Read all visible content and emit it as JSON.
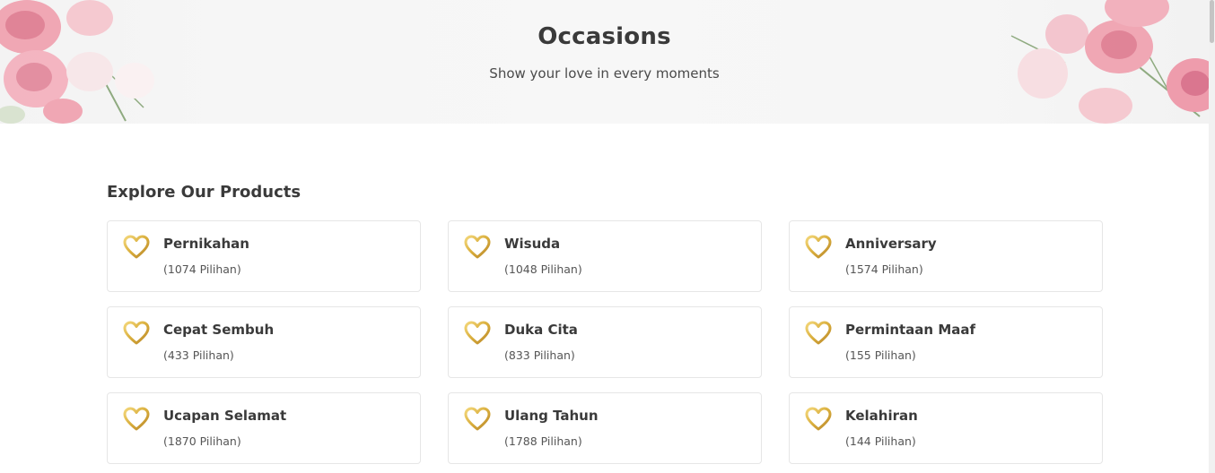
{
  "hero": {
    "title": "Occasions",
    "subtitle": "Show your love in every moments"
  },
  "section": {
    "title": "Explore Our Products"
  },
  "categories": [
    {
      "name": "Pernikahan",
      "count": "(1074 Pilihan)"
    },
    {
      "name": "Wisuda",
      "count": "(1048 Pilihan)"
    },
    {
      "name": "Anniversary",
      "count": "(1574 Pilihan)"
    },
    {
      "name": "Cepat Sembuh",
      "count": "(433 Pilihan)"
    },
    {
      "name": "Duka Cita",
      "count": "(833 Pilihan)"
    },
    {
      "name": "Permintaan Maaf",
      "count": "(155 Pilihan)"
    },
    {
      "name": "Ucapan Selamat",
      "count": "(1870 Pilihan)"
    },
    {
      "name": "Ulang Tahun",
      "count": "(1788 Pilihan)"
    },
    {
      "name": "Kelahiran",
      "count": "(144 Pilihan)"
    }
  ],
  "icons": {
    "category": "heart-icon",
    "hero_decoration": "flowers-icon"
  },
  "colors": {
    "heart_gold": "#d9ae3c",
    "heart_gold_light": "#f3d77a",
    "text_dark": "#3a3a3a",
    "card_border": "#e6e6e6",
    "flower_pink": "#f0a3b1",
    "flower_white": "#fbeff0"
  }
}
